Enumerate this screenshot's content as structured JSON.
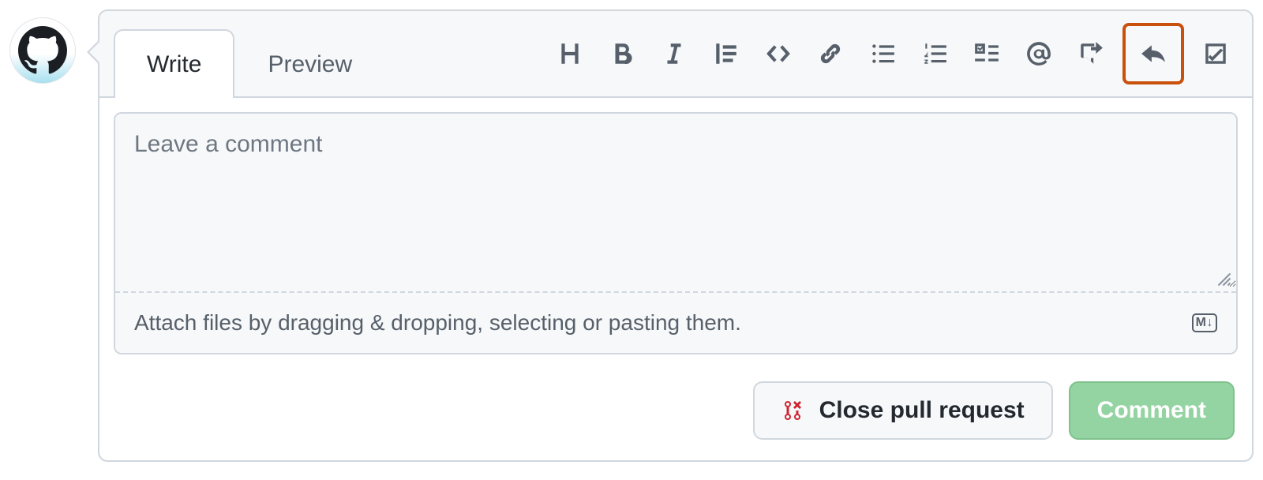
{
  "tabs": {
    "write": "Write",
    "preview": "Preview"
  },
  "editor": {
    "placeholder": "Leave a comment",
    "value": "",
    "attach_hint": "Attach files by dragging & dropping, selecting or pasting them.",
    "markdown_badge": "M↓"
  },
  "toolbar": {
    "icons": [
      "heading",
      "bold",
      "italic",
      "quote",
      "code",
      "link",
      "ul",
      "ol",
      "tasklist",
      "mention",
      "crossref",
      "reply",
      "suggestion"
    ]
  },
  "actions": {
    "close": "Close pull request",
    "comment": "Comment"
  },
  "colors": {
    "highlight": "#c9510c",
    "primary_bg": "#94d3a2",
    "pr_icon": "#cf222e"
  }
}
